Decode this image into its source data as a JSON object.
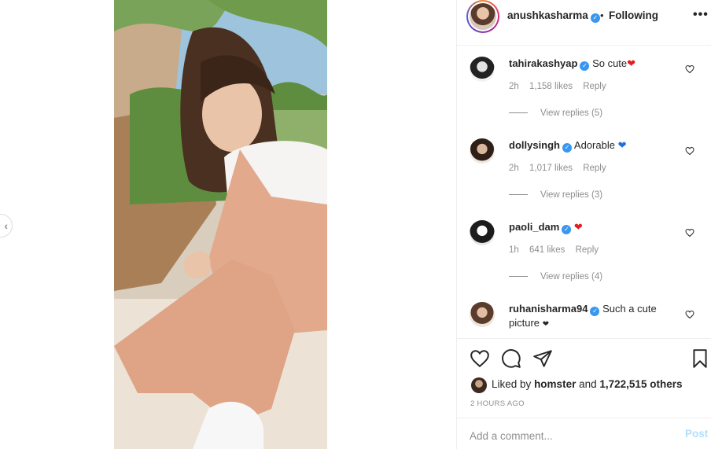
{
  "post": {
    "username": "anushkasharma",
    "separator": "•",
    "follow_status": "Following",
    "more_icon": "more-horizontal-icon"
  },
  "comments": [
    {
      "username": "tahirakashyap",
      "text": "So cute",
      "emoji": "red-heart",
      "time": "2h",
      "likes": "1,158 likes",
      "reply": "Reply",
      "view_replies": "View replies (5)",
      "verified": true
    },
    {
      "username": "dollysingh",
      "text": "Adorable",
      "emoji": "blue-heart",
      "time": "2h",
      "likes": "1,017 likes",
      "reply": "Reply",
      "view_replies": "View replies (3)",
      "verified": true
    },
    {
      "username": "paoli_dam",
      "text": "",
      "emoji": "red-heart",
      "time": "1h",
      "likes": "641 likes",
      "reply": "Reply",
      "view_replies": "View replies (4)",
      "verified": true
    },
    {
      "username": "ruhanisharma94",
      "text": "Such a cute picture",
      "emoji": "black-heart",
      "verified": true
    }
  ],
  "actions": {
    "like_icon": "heart-outline-icon",
    "comment_icon": "comment-bubble-icon",
    "share_icon": "paper-plane-icon",
    "save_icon": "bookmark-icon"
  },
  "likes": {
    "prefix": "Liked by",
    "user": "homster",
    "joiner": "and",
    "count": "1,722,515 others"
  },
  "timestamp": "2 HOURS AGO",
  "add_comment": {
    "placeholder": "Add a comment...",
    "post_label": "Post"
  },
  "colors": {
    "verified_blue": "#3897f0",
    "post_disabled": "#b2dffc",
    "heart_red": "#e41d1d",
    "heart_blue": "#1f6fe0"
  }
}
